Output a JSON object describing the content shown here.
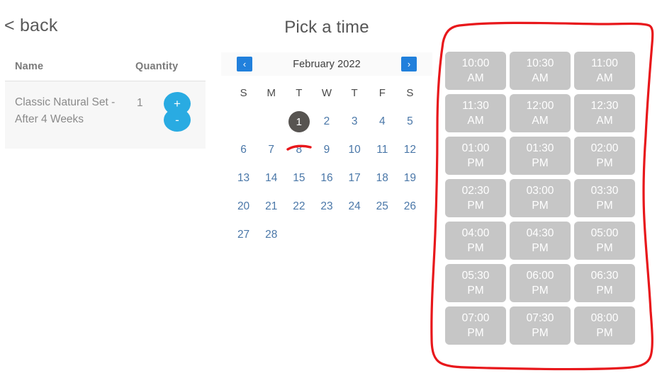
{
  "nav": {
    "back_label": "< back"
  },
  "cart": {
    "columns": [
      "Name",
      "Quantity"
    ],
    "rows": [
      {
        "name": "Classic Natural Set - After 4 Weeks",
        "quantity": "1",
        "increase_label": "+",
        "decrease_label": "-"
      }
    ]
  },
  "calendar": {
    "title": "Pick a time",
    "month_label": "February 2022",
    "prev_label": "‹",
    "next_label": "›",
    "weekdays": [
      "S",
      "M",
      "T",
      "W",
      "T",
      "F",
      "S"
    ],
    "leading_blanks": 2,
    "days": [
      "1",
      "2",
      "3",
      "4",
      "5",
      "6",
      "7",
      "8",
      "9",
      "10",
      "11",
      "12",
      "13",
      "14",
      "15",
      "16",
      "17",
      "18",
      "19",
      "20",
      "21",
      "22",
      "23",
      "24",
      "25",
      "26",
      "27",
      "28"
    ],
    "selected_day": "1"
  },
  "time_slots": {
    "slots": [
      {
        "time": "10:00",
        "meridiem": "AM"
      },
      {
        "time": "10:30",
        "meridiem": "AM"
      },
      {
        "time": "11:00",
        "meridiem": "AM"
      },
      {
        "time": "11:30",
        "meridiem": "AM"
      },
      {
        "time": "12:00",
        "meridiem": "AM"
      },
      {
        "time": "12:30",
        "meridiem": "AM"
      },
      {
        "time": "01:00",
        "meridiem": "PM"
      },
      {
        "time": "01:30",
        "meridiem": "PM"
      },
      {
        "time": "02:00",
        "meridiem": "PM"
      },
      {
        "time": "02:30",
        "meridiem": "PM"
      },
      {
        "time": "03:00",
        "meridiem": "PM"
      },
      {
        "time": "03:30",
        "meridiem": "PM"
      },
      {
        "time": "04:00",
        "meridiem": "PM"
      },
      {
        "time": "04:30",
        "meridiem": "PM"
      },
      {
        "time": "05:00",
        "meridiem": "PM"
      },
      {
        "time": "05:30",
        "meridiem": "PM"
      },
      {
        "time": "06:00",
        "meridiem": "PM"
      },
      {
        "time": "06:30",
        "meridiem": "PM"
      },
      {
        "time": "07:00",
        "meridiem": "PM"
      },
      {
        "time": "07:30",
        "meridiem": "PM"
      },
      {
        "time": "08:00",
        "meridiem": "PM"
      }
    ]
  },
  "colors": {
    "accent_blue": "#29abe2",
    "nav_blue": "#2180dc",
    "slot_gray": "#c6c6c6",
    "selected_day": "#575451",
    "annotation_red": "#e8171b",
    "day_link": "#4a77a8"
  }
}
